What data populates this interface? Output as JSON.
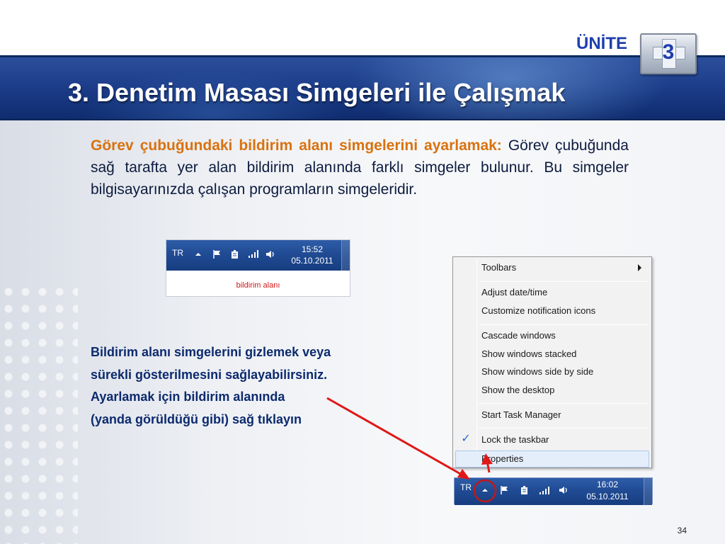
{
  "header": {
    "unite_label": "ÜNİTE",
    "unite_number": "3",
    "title": "3. Denetim Masası Simgeleri ile Çalışmak"
  },
  "intro": {
    "heading": "Görev çubuğundaki bildirim alanı simgelerini ayarlamak:",
    "body": "Görev çubuğunda sağ tarafta yer alan bildirim alanında farklı simgeler bulunur. Bu simgeler bilgisayarınızda çalışan programların simgeleridir."
  },
  "tray_example": {
    "language": "TR",
    "time": "15:52",
    "date": "05.10.2011",
    "caption": "bildirim alanı"
  },
  "instructions": {
    "lines": [
      "Bildirim alanı simgelerini gizlemek veya",
      "sürekli gösterilmesini sağlayabilirsiniz.",
      "Ayarlamak için bildirim alanında",
      "(yanda görüldüğü gibi) sağ tıklayın"
    ]
  },
  "context_menu": {
    "items": [
      "Toolbars",
      "Adjust date/time",
      "Customize notification icons",
      "Cascade windows",
      "Show windows stacked",
      "Show windows side by side",
      "Show the desktop",
      "Start Task Manager",
      "Lock the taskbar",
      "Properties"
    ],
    "checked_item": "Lock the taskbar",
    "highlighted_item": "Properties"
  },
  "taskbar": {
    "language": "TR",
    "time": "16:02",
    "date": "05.10.2011"
  },
  "icons": [
    "show-hidden-icons-arrow",
    "action-center-flag-icon",
    "power-icon",
    "network-signal-icon",
    "volume-icon",
    "show-desktop-icon"
  ],
  "colors": {
    "banner": "#1a3a86",
    "heading_orange": "#d9720f",
    "instruction_blue": "#0c2a6e",
    "annotation_red": "#e01818"
  },
  "page_number": "34"
}
